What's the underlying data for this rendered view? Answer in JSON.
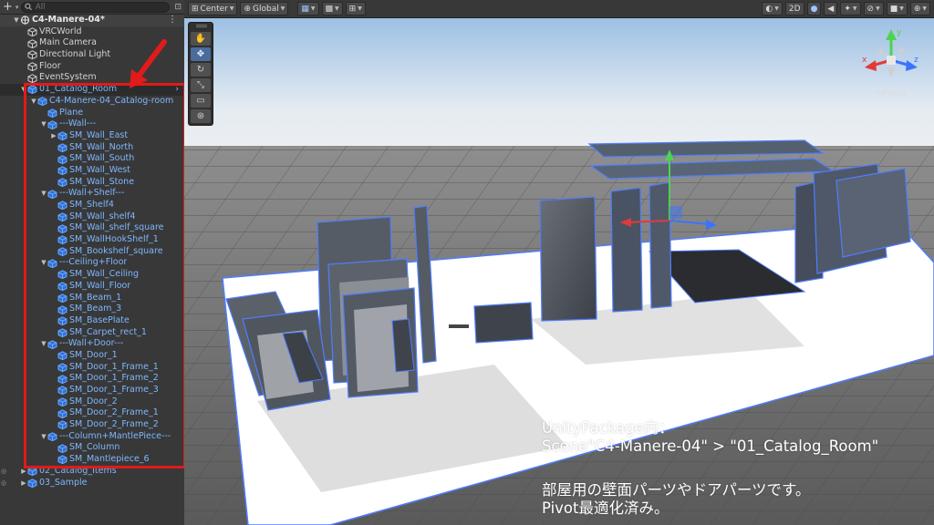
{
  "hierarchy": {
    "search_placeholder": "All",
    "rows": [
      {
        "label": "C4-Manere-04*",
        "type": "scene",
        "depth": 0,
        "arrow": "▼"
      },
      {
        "label": "VRCWorld",
        "depth": 1
      },
      {
        "label": "Main Camera",
        "depth": 1
      },
      {
        "label": "Directional Light",
        "depth": 1
      },
      {
        "label": "Floor",
        "depth": 1
      },
      {
        "label": "EventSystem",
        "depth": 1
      },
      {
        "label": "01_Catalog_Room",
        "depth": 1,
        "blue": true,
        "selected": true,
        "arrow": "▼",
        "chevron": true
      },
      {
        "label": "C4-Manere-04_Catalog-room",
        "depth": 2,
        "blue": true,
        "arrow": "▼"
      },
      {
        "label": "Plane",
        "depth": 3,
        "blue": true
      },
      {
        "label": "---Wall---",
        "depth": 3,
        "blue": true,
        "arrow": "▼"
      },
      {
        "label": "SM_Wall_East",
        "depth": 4,
        "blue": true,
        "arrow": "▶"
      },
      {
        "label": "SM_Wall_North",
        "depth": 4,
        "blue": true
      },
      {
        "label": "SM_Wall_South",
        "depth": 4,
        "blue": true
      },
      {
        "label": "SM_Wall_West",
        "depth": 4,
        "blue": true
      },
      {
        "label": "SM_Wall_Stone",
        "depth": 4,
        "blue": true
      },
      {
        "label": "---Wall+Shelf---",
        "depth": 3,
        "blue": true,
        "arrow": "▼"
      },
      {
        "label": "SM_Shelf4",
        "depth": 4,
        "blue": true
      },
      {
        "label": "SM_Wall_shelf4",
        "depth": 4,
        "blue": true
      },
      {
        "label": "SM_Wall_shelf_square",
        "depth": 4,
        "blue": true
      },
      {
        "label": "SM_WallHookShelf_1",
        "depth": 4,
        "blue": true
      },
      {
        "label": "SM_Bookshelf_square",
        "depth": 4,
        "blue": true
      },
      {
        "label": "---Ceiling+Floor",
        "depth": 3,
        "blue": true,
        "arrow": "▼"
      },
      {
        "label": "SM_Wall_Ceiling",
        "depth": 4,
        "blue": true
      },
      {
        "label": "SM_Wall_Floor",
        "depth": 4,
        "blue": true
      },
      {
        "label": "SM_Beam_1",
        "depth": 4,
        "blue": true
      },
      {
        "label": "SM_Beam_3",
        "depth": 4,
        "blue": true
      },
      {
        "label": "SM_BasePlate",
        "depth": 4,
        "blue": true
      },
      {
        "label": "SM_Carpet_rect_1",
        "depth": 4,
        "blue": true
      },
      {
        "label": "---Wall+Door---",
        "depth": 3,
        "blue": true,
        "arrow": "▼"
      },
      {
        "label": "SM_Door_1",
        "depth": 4,
        "blue": true
      },
      {
        "label": "SM_Door_1_Frame_1",
        "depth": 4,
        "blue": true
      },
      {
        "label": "SM_Door_1_Frame_2",
        "depth": 4,
        "blue": true
      },
      {
        "label": "SM_Door_1_Frame_3",
        "depth": 4,
        "blue": true
      },
      {
        "label": "SM_Door_2",
        "depth": 4,
        "blue": true
      },
      {
        "label": "SM_Door_2_Frame_1",
        "depth": 4,
        "blue": true
      },
      {
        "label": "SM_Door_2_Frame_2",
        "depth": 4,
        "blue": true
      },
      {
        "label": "---Column+MantlePiece---",
        "depth": 3,
        "blue": true,
        "arrow": "▼"
      },
      {
        "label": "SM_Column",
        "depth": 4,
        "blue": true
      },
      {
        "label": "SM_Mantlepiece_6",
        "depth": 4,
        "blue": true
      },
      {
        "label": "02_Catalog_Items",
        "depth": 1,
        "blue": true,
        "arrow": "▶",
        "eye": true
      },
      {
        "label": "03_Sample",
        "depth": 1,
        "blue": true,
        "arrow": "▶",
        "eye": true
      }
    ]
  },
  "scene_toolbar": {
    "pivot_label": "Center",
    "space_label": "Global",
    "mode_2d": "2D"
  },
  "scene": {
    "projection_label": "Persp",
    "gizmo_axes": {
      "y": "y",
      "x": "x",
      "z": "z"
    }
  },
  "caption": {
    "line1": "UnityPackage内：",
    "line2": "Scene\"C4-Manere-04\" > \"01_Catalog_Room\"",
    "line3": "部屋用の壁面パーツやドアパーツです。",
    "line4": "Pivot最適化済み。"
  },
  "colors": {
    "highlight_box": "#e21a1a",
    "prefab_text": "#7fb7ff",
    "axis_x": "#e23a3a",
    "axis_y": "#4fd24f",
    "axis_z": "#3b73ff"
  }
}
